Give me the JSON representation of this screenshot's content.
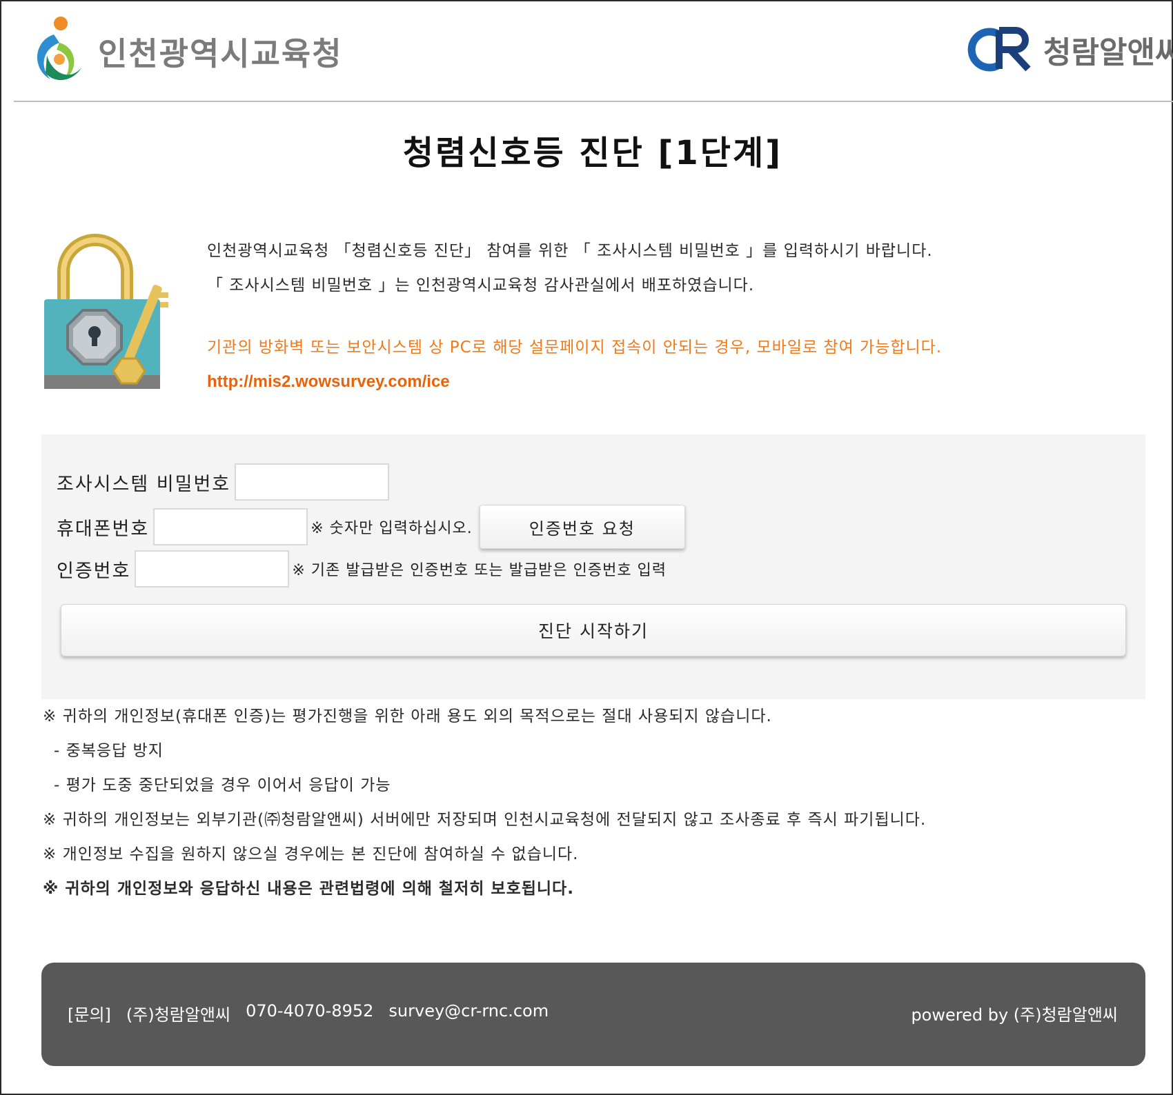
{
  "header": {
    "org_name": "인천광역시교육청",
    "company_name": "청람알앤씨"
  },
  "page_title": "청렴신호등 진단 [1단계]",
  "intro": {
    "line1": "인천광역시교육청 「청렴신호등 진단」 참여를 위한 「 조사시스템 비밀번호 」를 입력하시기 바랍니다.",
    "line2": "「 조사시스템 비밀번호 」는 인천광역시교육청 감사관실에서 배포하였습니다.",
    "warning": "기관의 방화벽 또는 보안시스템 상 PC로 해당 설문페이지 접속이 안되는 경우, 모바일로 참여 가능합니다.",
    "url": "http://mis2.wowsurvey.com/ice"
  },
  "form": {
    "password_label": "조사시스템 비밀번호",
    "password_value": "",
    "phone_label": "휴대폰번호",
    "phone_value": "",
    "phone_hint": "※ 숫자만 입력하십시오.",
    "request_button": "인증번호 요청",
    "auth_label": "인증번호",
    "auth_value": "",
    "auth_hint": "※ 기존 발급받은 인증번호 또는 발급받은 인증번호 입력",
    "start_button": "진단 시작하기"
  },
  "notices": [
    "※ 귀하의 개인정보(휴대폰 인증)는 평가진행을 위한 아래 용도 외의 목적으로는 절대 사용되지 않습니다.",
    "- 중복응답 방지",
    "- 평가 도중 중단되었을 경우 이어서 응답이 가능",
    "※ 귀하의 개인정보는 외부기관(㈜청람알앤씨) 서버에만 저장되며 인천시교육청에 전달되지 않고 조사종료 후 즉시 파기됩니다.",
    "※ 개인정보 수집을 원하지 않으실 경우에는 본 진단에 참여하실 수 없습니다.",
    "※ 귀하의 개인정보와 응답하신 내용은 관련법령에 의해 철저히 보호됩니다."
  ],
  "footer": {
    "inquiry": "[문의]",
    "company": "(주)청람알앤씨",
    "phone": "070-4070-8952",
    "email": "survey@cr-rnc.com",
    "powered_by": "powered by (주)청람알앤씨"
  },
  "colors": {
    "warning": "#f07a1a",
    "footer_bg": "#585858",
    "panel_bg": "#f4f4f4",
    "logo_blue": "#1e4f9a"
  }
}
